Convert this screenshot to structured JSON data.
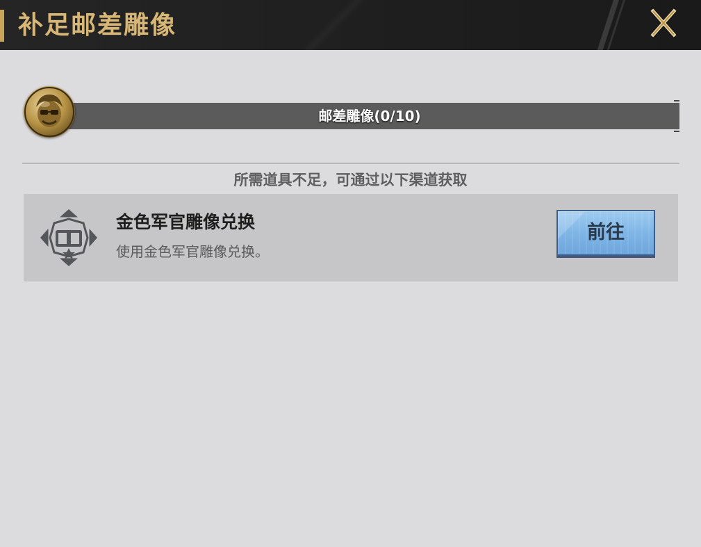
{
  "header": {
    "title": "补足邮差雕像",
    "close_icon": "close-icon",
    "accent_color": "#c9a55c"
  },
  "progress": {
    "label": "邮差雕像(0/10)",
    "current": 0,
    "total": 10,
    "portrait_icon": "postman-statue-icon"
  },
  "hint": "所需道具不足，可通过以下渠道获取",
  "sources": [
    {
      "icon": "officer-exchange-icon",
      "title": "金色军官雕像兑换",
      "description": "使用金色军官雕像兑换。",
      "button_label": "前往"
    }
  ]
}
